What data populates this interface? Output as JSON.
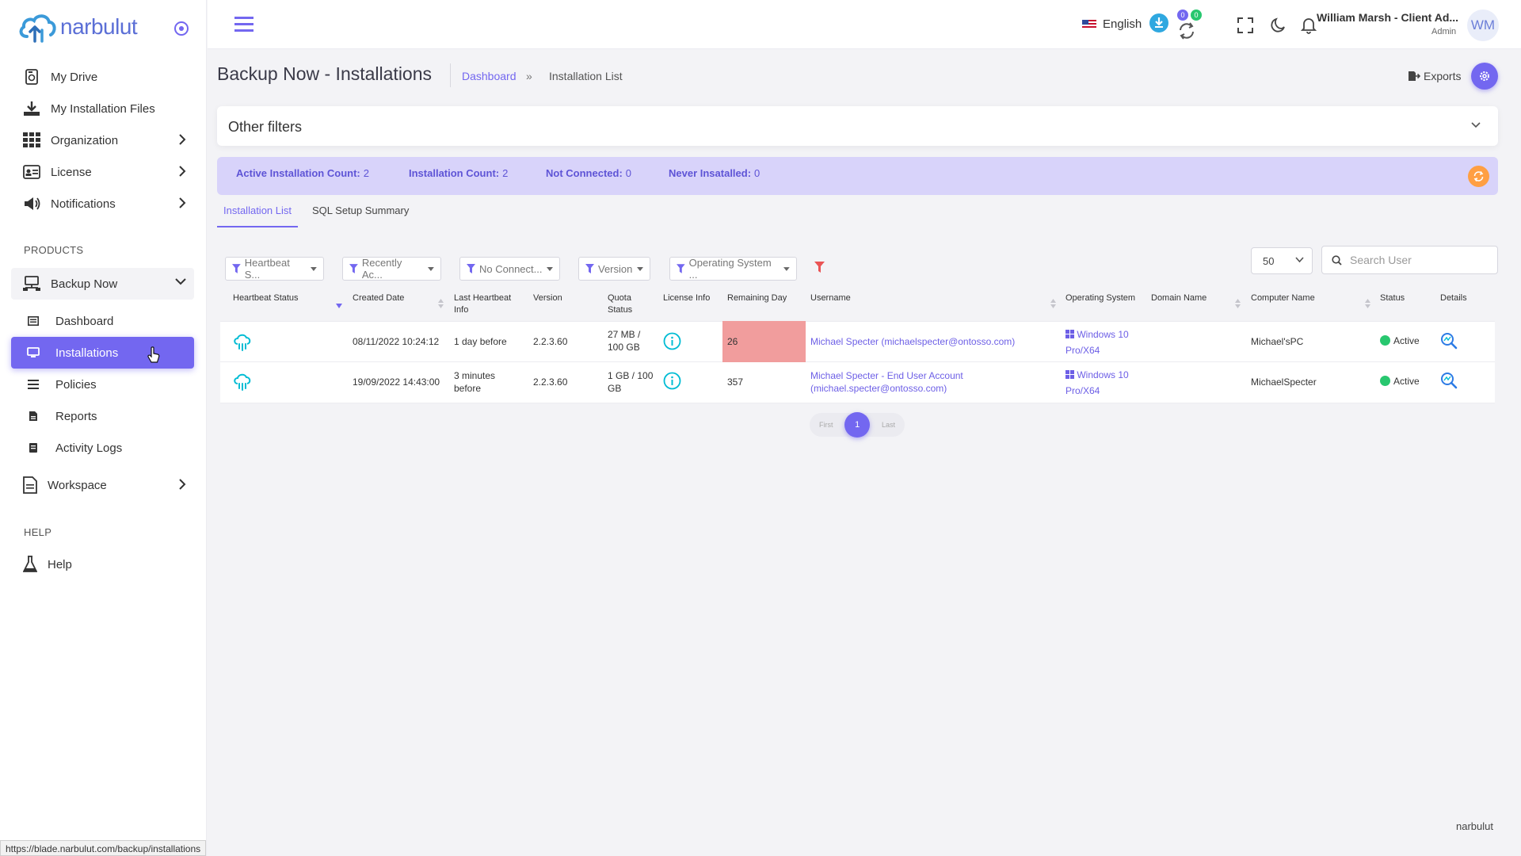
{
  "brand": {
    "name": "narbulut",
    "footer": "narbulut"
  },
  "sidebar": {
    "items": [
      {
        "label": "My Drive"
      },
      {
        "label": "My Installation Files"
      },
      {
        "label": "Organization"
      },
      {
        "label": "License"
      },
      {
        "label": "Notifications"
      }
    ],
    "products_label": "PRODUCTS",
    "backup_now": {
      "label": "Backup Now",
      "children": [
        {
          "label": "Dashboard"
        },
        {
          "label": "Installations"
        },
        {
          "label": "Policies"
        },
        {
          "label": "Reports"
        },
        {
          "label": "Activity Logs"
        }
      ]
    },
    "workspace": {
      "label": "Workspace"
    },
    "help_label": "HELP",
    "help": {
      "label": "Help"
    }
  },
  "topbar": {
    "language": "English",
    "download_badge": "0",
    "sync_badge": "0",
    "user_name": "William Marsh - Client Ad...",
    "user_role": "Admin",
    "avatar_initials": "WM"
  },
  "page": {
    "title": "Backup Now - Installations",
    "breadcrumb_link": "Dashboard",
    "breadcrumb_sep": "»",
    "breadcrumb_current": "Installation List",
    "exports_label": "Exports"
  },
  "filters": {
    "title": "Other filters"
  },
  "counts": [
    {
      "label": "Active Installation Count:",
      "value": "2"
    },
    {
      "label": "Installation Count:",
      "value": "2"
    },
    {
      "label": "Not Connected:",
      "value": "0"
    },
    {
      "label": "Never Insatalled:",
      "value": "0"
    }
  ],
  "tabs": [
    {
      "label": "Installation List"
    },
    {
      "label": "SQL Setup Summary"
    }
  ],
  "toolbar": {
    "filter_buttons": [
      {
        "label": "Heartbeat S..."
      },
      {
        "label": "Recently Ac..."
      },
      {
        "label": "No Connect..."
      },
      {
        "label": "Version"
      },
      {
        "label": "Operating System ..."
      }
    ],
    "page_size": "50",
    "search_placeholder": "Search User"
  },
  "table": {
    "headers": {
      "heartbeat": "Heartbeat Status",
      "created": "Created Date",
      "last_hb_1": "Last Heartbeat",
      "last_hb_2": "Info",
      "version": "Version",
      "quota_1": "Quota",
      "quota_2": "Status",
      "license": "License Info",
      "remaining": "Remaining Day",
      "username": "Username",
      "os": "Operating System",
      "domain": "Domain Name",
      "computer": "Computer Name",
      "status": "Status",
      "details": "Details"
    },
    "rows": [
      {
        "created": "08/11/2022 10:24:12",
        "last_hb_1": "1 day before",
        "last_hb_2": "",
        "version": "2.2.3.60",
        "quota_1": "27 MB /",
        "quota_2": "100 GB",
        "remaining": "26",
        "username_1": "Michael Specter (michaelspecter@ontosso.com)",
        "username_2": "",
        "os_1": "Windows 10",
        "os_2": "Pro/X64",
        "domain": "",
        "computer": "Michael'sPC",
        "status": "Active"
      },
      {
        "created": "19/09/2022 14:43:00",
        "last_hb_1": "3 minutes",
        "last_hb_2": "before",
        "version": "2.2.3.60",
        "quota_1": "1 GB / 100",
        "quota_2": "GB",
        "remaining": "357",
        "username_1": "Michael Specter - End User Account",
        "username_2": "(michael.specter@ontosso.com)",
        "os_1": "Windows 10",
        "os_2": "Pro/X64",
        "domain": "",
        "computer": "MichaelSpecter",
        "status": "Active"
      }
    ]
  },
  "pagination": {
    "first": "First",
    "current": "1",
    "last": "Last"
  },
  "status_url": "https://blade.narbulut.com/backup/installations",
  "colors": {
    "accent": "#7367f0",
    "counts_bg": "#d8d3fa",
    "hot": "#f19d9d",
    "active": "#28c76f",
    "teal": "#00bcd4",
    "orange": "#ff9f43"
  }
}
